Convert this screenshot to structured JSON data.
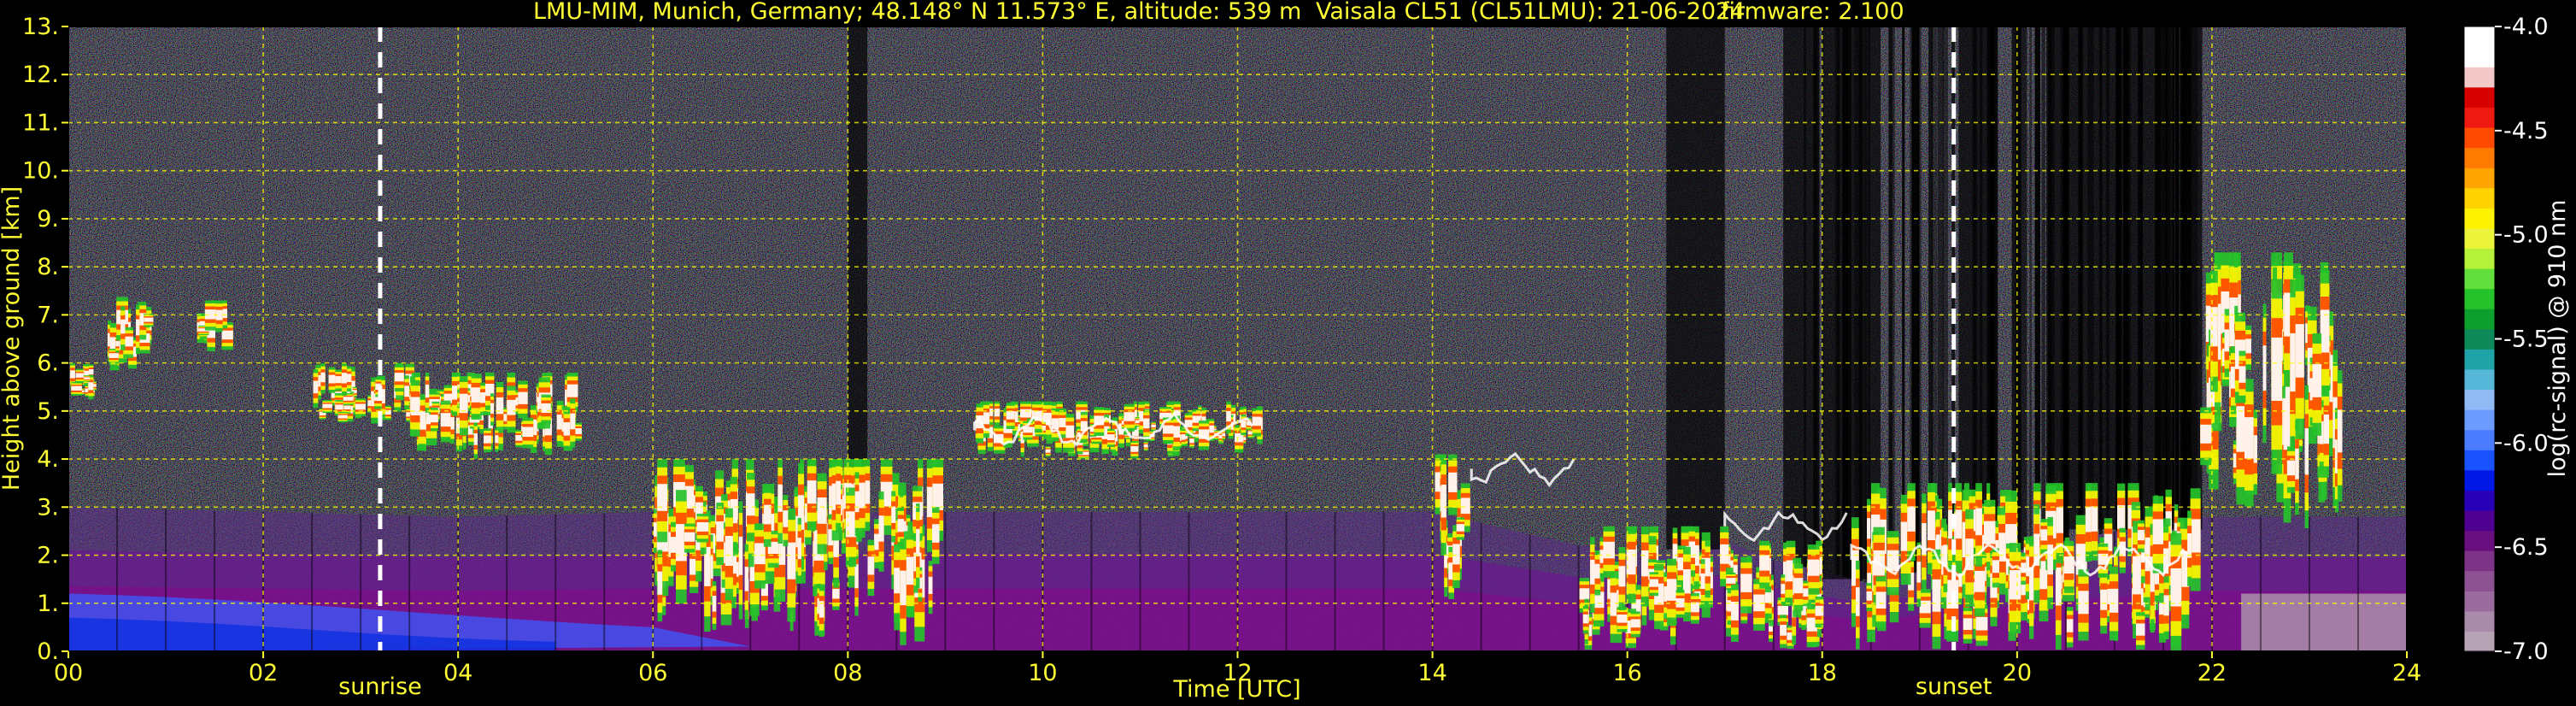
{
  "header": {
    "station": "LMU-MIM, Munich, Germany; 48.148° N 11.573° E, altitude: 539 m",
    "instrument": "Vaisala CL51 (CL51LMU): 21-06-2024",
    "firmware": "firmware: 2.100"
  },
  "colorbar": {
    "label": "log(rc-signal) @ 910 nm",
    "ticks": [
      "-4.0",
      "-4.5",
      "-5.0",
      "-5.5",
      "-6.0",
      "-6.5",
      "-7.0"
    ],
    "range": [
      -7.0,
      -4.0
    ],
    "colors": [
      "#b6a3b4",
      "#a88aa9",
      "#9a6c9d",
      "#8d5291",
      "#7d3486",
      "#6a0f80",
      "#4f0090",
      "#2800b8",
      "#0018e6",
      "#1b52ff",
      "#4a7cff",
      "#6c9cff",
      "#8fbaf3",
      "#56b7d8",
      "#1fa3a6",
      "#0e8a5a",
      "#0e9e2e",
      "#26c22a",
      "#63df3d",
      "#b6f23a",
      "#ecf33b",
      "#fff200",
      "#ffd200",
      "#ffa400",
      "#ff7a00",
      "#ff4a00",
      "#ee1a12",
      "#d60000",
      "#f3c8c8",
      "#ffffff",
      "#ffffff"
    ]
  },
  "chart_data": {
    "type": "heatmap",
    "title": "LMU-MIM, Munich, Germany; 48.148° N 11.573° E, altitude: 539 m    Vaisala CL51 (CL51LMU): 21-06-2024    firmware: 2.100",
    "xlabel": "Time [UTC]",
    "ylabel": "Height above ground [km]",
    "xlim": [
      0,
      24
    ],
    "ylim": [
      0,
      13
    ],
    "xticks": [
      "00",
      "02",
      "04",
      "06",
      "08",
      "10",
      "12",
      "14",
      "16",
      "18",
      "20",
      "22",
      "24"
    ],
    "yticks": [
      "0.",
      "1.",
      "2.",
      "3.",
      "4.",
      "5.",
      "6.",
      "7.",
      "8.",
      "9.",
      "10.",
      "11.",
      "12.",
      "13."
    ],
    "grid": true,
    "annotations": [
      {
        "label": "sunrise",
        "x": 3.2
      },
      {
        "label": "sunset",
        "x": 19.35
      }
    ],
    "colorbar_label": "log(rc-signal) @ 910 nm",
    "colorbar_range": [
      -7.0,
      -4.0
    ],
    "features": {
      "boundary_layer_top_km": [
        [
          0.0,
          3.0
        ],
        [
          2.0,
          2.9
        ],
        [
          4.0,
          2.8
        ],
        [
          6.0,
          2.9
        ],
        [
          8.0,
          2.9
        ],
        [
          10.0,
          2.9
        ],
        [
          12.0,
          2.9
        ],
        [
          14.0,
          2.9
        ],
        [
          15.5,
          2.2
        ],
        [
          16.5,
          2.0
        ],
        [
          17.0,
          2.3
        ],
        [
          17.5,
          1.9
        ],
        [
          18.5,
          1.4
        ],
        [
          19.2,
          1.8
        ],
        [
          20.0,
          2.1
        ],
        [
          21.0,
          2.5
        ],
        [
          21.8,
          2.8
        ]
      ],
      "cloud_layers": [
        {
          "t_start": 0.0,
          "t_end": 0.3,
          "h_low": 5.2,
          "h_high": 6.0
        },
        {
          "t_start": 0.4,
          "t_end": 0.8,
          "h_low": 5.8,
          "h_high": 7.4
        },
        {
          "t_start": 1.3,
          "t_end": 1.6,
          "h_low": 6.2,
          "h_high": 7.3
        },
        {
          "t_start": 2.5,
          "t_end": 3.5,
          "h_low": 4.6,
          "h_high": 6.0
        },
        {
          "t_start": 3.5,
          "t_end": 5.2,
          "h_low": 4.0,
          "h_high": 5.8
        },
        {
          "t_start": 6.0,
          "t_end": 8.3,
          "h_low": 0.3,
          "h_high": 4.0
        },
        {
          "t_start": 8.3,
          "t_end": 8.9,
          "h_low": 0.1,
          "h_high": 4.0
        },
        {
          "t_start": 9.3,
          "t_end": 12.2,
          "h_low": 4.0,
          "h_high": 5.2
        },
        {
          "t_start": 14.0,
          "t_end": 14.3,
          "h_low": 1.0,
          "h_high": 4.1
        },
        {
          "t_start": 15.5,
          "t_end": 17.0,
          "h_low": 0.0,
          "h_high": 2.6
        },
        {
          "t_start": 17.0,
          "t_end": 18.0,
          "h_low": 0.0,
          "h_high": 2.3
        },
        {
          "t_start": 18.3,
          "t_end": 21.8,
          "h_low": 0.0,
          "h_high": 3.5
        },
        {
          "t_start": 21.8,
          "t_end": 23.3,
          "h_low": 2.5,
          "h_high": 8.3
        }
      ]
    }
  }
}
